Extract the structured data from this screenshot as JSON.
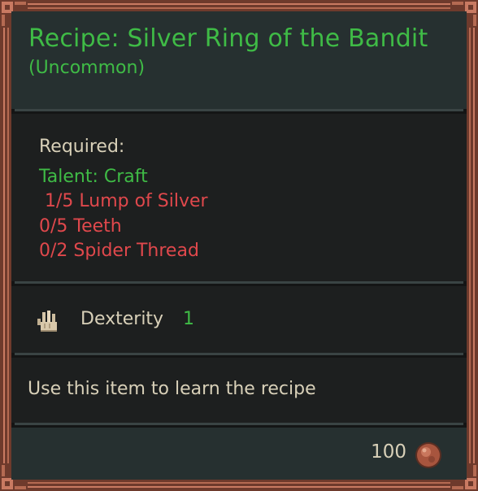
{
  "tooltip": {
    "title": "Recipe: Silver Ring of the Bandit",
    "rarity": "(Uncommon)",
    "requirements": {
      "heading": "Required:",
      "talent": "Talent: Craft",
      "items": [
        " 1/5 Lump of Silver",
        "0/5 Teeth",
        "0/2 Spider Thread"
      ]
    },
    "stat": {
      "icon": "hand-icon",
      "label": "Dexterity",
      "value": "1"
    },
    "description": "Use this item to learn the recipe",
    "price": {
      "value": "100",
      "icon": "coin-icon"
    }
  },
  "colors": {
    "frame": "#6e3a2c",
    "frame_highlight": "#c97a62",
    "panel": "#1d1f1f",
    "header": "#263030",
    "uncommon_green": "#3fbb46",
    "missing_red": "#e0484c",
    "text": "#d8d0b8"
  }
}
